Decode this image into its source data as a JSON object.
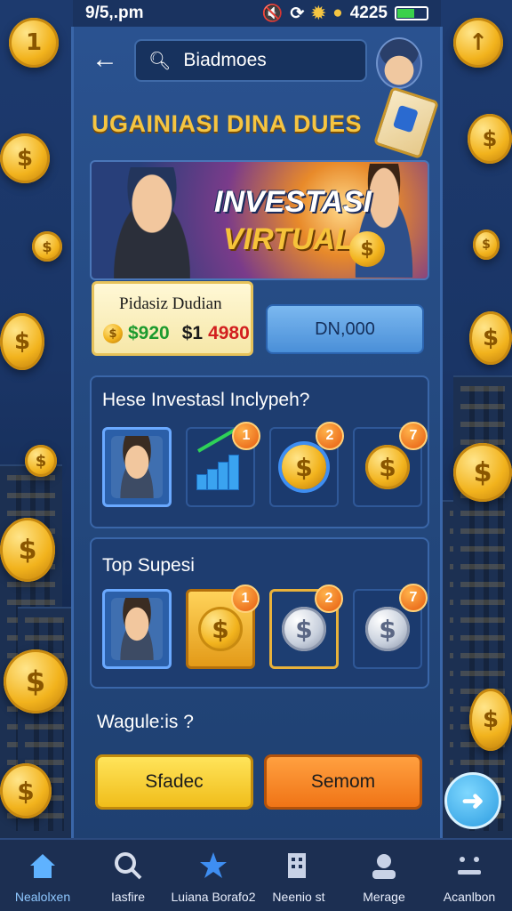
{
  "status_bar": {
    "time": "9/5,.pm",
    "battery_text": "4225"
  },
  "search": {
    "value": "Biadmoes"
  },
  "page_title": "UGAINIASI DINA DUES",
  "banner": {
    "line1": "INVESTASI",
    "line2": "VIRTUAL"
  },
  "stat_card": {
    "label": "Pidasiz Dudian",
    "value_green": "$920",
    "value_red_prefix": "$1",
    "value_red": "4980"
  },
  "stat_button_label": "DN,000",
  "section1": {
    "title": "Hese Investasl Inclypeh?",
    "tiles": [
      {
        "icon": "avatar-icon",
        "badge": ""
      },
      {
        "icon": "growth-chart-icon",
        "badge": "1"
      },
      {
        "icon": "coin-icon",
        "badge": "2"
      },
      {
        "icon": "coin-stack-icon",
        "badge": "7"
      }
    ]
  },
  "section2": {
    "title": "Top Supesi",
    "tiles": [
      {
        "icon": "avatar-icon",
        "badge": ""
      },
      {
        "icon": "gold-coin-icon",
        "badge": "1"
      },
      {
        "icon": "silver-coin-stack-icon",
        "badge": "2"
      },
      {
        "icon": "silver-coin-stack-icon",
        "badge": "7"
      }
    ]
  },
  "question_label": "Wagule:is ?",
  "buttons": {
    "yellow": "Sfadec",
    "orange": "Semom"
  },
  "bottom_nav": [
    {
      "label": "Nealolxen",
      "icon": "home-icon",
      "active": true
    },
    {
      "label": "Iasfire",
      "icon": "search-icon",
      "active": false
    },
    {
      "label": "Luiana Borafo2",
      "icon": "star-icon",
      "active": false
    },
    {
      "label": "Neenio st",
      "icon": "building-icon",
      "active": false
    },
    {
      "label": "Merage",
      "icon": "profile-icon",
      "active": false
    },
    {
      "label": "Acanlbon",
      "icon": "menu-icon",
      "active": false
    }
  ],
  "colors": {
    "accent_gold": "#f5c542",
    "panel_blue": "#24497f",
    "nav_active": "#8fc8ff"
  }
}
